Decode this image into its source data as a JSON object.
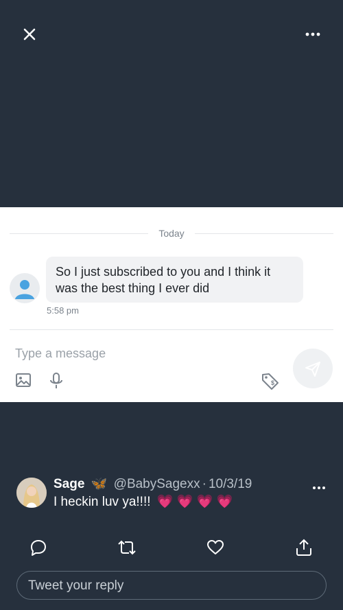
{
  "header": {
    "close_icon": "close-icon",
    "more_icon": "more-horizontal-icon"
  },
  "dm_card": {
    "date_separator": "Today",
    "message": {
      "text": "So I just subscribed to you and I think it was the best thing I ever did",
      "time": "5:58 pm",
      "sender_avatar": "default-user-avatar"
    },
    "composer": {
      "placeholder": "Type a message",
      "icons": [
        "image-icon",
        "microphone-icon",
        "price-tag-icon",
        "send-icon"
      ]
    }
  },
  "tweet": {
    "name": "Sage",
    "badge_emoji": "🦋",
    "handle": "@BabySagexx",
    "separator": "·",
    "date": "10/3/19",
    "text": "I heckin luv ya!!!!",
    "hearts": "💗 💗 💗 💗",
    "actions": [
      "reply-icon",
      "retweet-icon",
      "like-icon",
      "share-icon"
    ]
  },
  "reply": {
    "placeholder": "Tweet your reply"
  },
  "colors": {
    "background": "#26303d",
    "card": "#ffffff",
    "bubble": "#f1f2f4",
    "icon_gray": "#7b838c"
  }
}
